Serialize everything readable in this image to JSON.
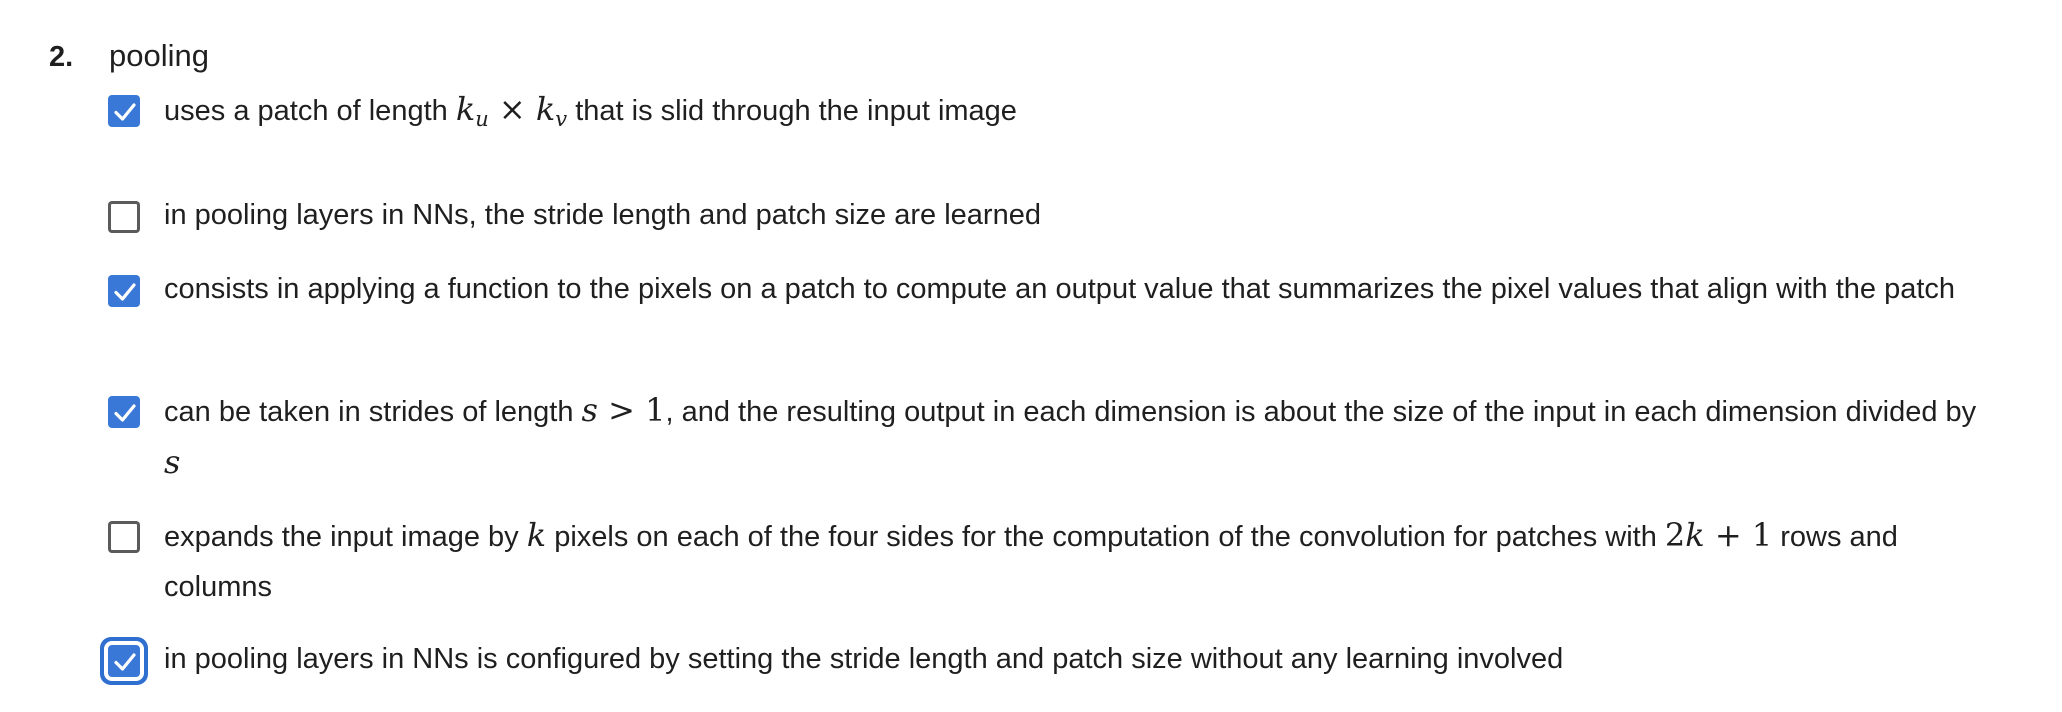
{
  "question": {
    "number": "2.",
    "title": "pooling"
  },
  "options": [
    {
      "checked": true,
      "text_pre": "uses a patch of length ",
      "math_a": "k",
      "math_a_sub": "u",
      "math_op": " × ",
      "math_b": "k",
      "math_b_sub": "v",
      "text_post": " that is slid through the input image"
    },
    {
      "checked": false,
      "text": "in pooling layers in NNs, the stride length and patch size are learned"
    },
    {
      "checked": true,
      "text": "consists in applying a function to the pixels on a patch to compute an output value that summarizes the pixel values that align with the patch"
    },
    {
      "checked": true,
      "text_pre": "can be taken in strides of length ",
      "math_s": "s",
      "math_gt": " > 1",
      "text_mid": ", and the resulting output in each dimension is about the size of the input in each dimension divided by ",
      "math_s2": "s"
    },
    {
      "checked": false,
      "text_pre": "expands the input image by ",
      "math_k": "k",
      "text_mid": " pixels on each of the four sides for the computation of the convolution for patches with ",
      "math_2k": "2",
      "math_2k_var": "k",
      "math_2k_rest": " + 1",
      "text_post": " rows and columns"
    },
    {
      "checked": true,
      "focused": true,
      "text": "in pooling layers in NNs is configured by setting the stride length and patch size without any learning involved"
    }
  ],
  "colors": {
    "check_fill": "#3a78d8",
    "focus_ring": "#2f6fd0",
    "unchecked_border": "#5b5b5b"
  }
}
